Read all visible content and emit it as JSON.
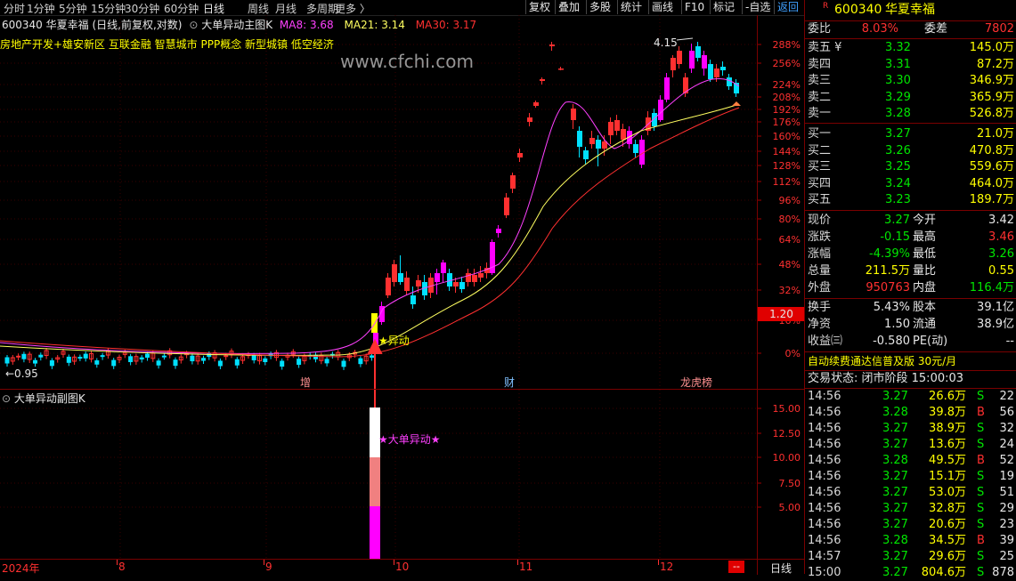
{
  "toolbar": {
    "periods": [
      "分时",
      "1分钟",
      "5分钟",
      "15分钟",
      "30分钟",
      "60分钟",
      "日线",
      "周线",
      "月线",
      "多周期",
      "更多 〉"
    ],
    "active": "日线",
    "right_buttons": [
      "复权",
      "叠加",
      "多股",
      "统计",
      "画线",
      "F10",
      "标记",
      "-自选",
      "返回"
    ]
  },
  "main_chart": {
    "stock_code": "600340",
    "stock_name": "华夏幸福",
    "desc": "(日线,前复权,对数)",
    "indicator": "大单异动主图K",
    "ma8_label": "MA8: 3.68",
    "ma21_label": "MA21: 3.14",
    "ma30_label": "MA30: 3.17",
    "concepts": "房地产开发+雄安新区 互联金融 智慧城市 PPP概念 新型城镇 低空经济",
    "watermark": "www.cfchi.com",
    "high_label": "4.15",
    "low_label": "←0.95",
    "signal_label": "★异动",
    "markers": {
      "zeng": "增",
      "cai": "财",
      "bang": "龙虎榜"
    },
    "current_price_tag": "1.20",
    "y_ticks": [
      "288%",
      "256%",
      "224%",
      "208%",
      "192%",
      "176%",
      "160%",
      "144%",
      "128%",
      "112%",
      "96%",
      "80%",
      "64%",
      "48%",
      "32%",
      "16%",
      "0%"
    ]
  },
  "sub_chart": {
    "title": "大单异动副图K",
    "signal_label": "★大单异动★",
    "y_ticks": [
      "15.00",
      "12.50",
      "10.00",
      "7.50",
      "5.00"
    ]
  },
  "x_axis": {
    "labels": [
      "2024年",
      "8",
      "9",
      "10",
      "11",
      "12"
    ],
    "end_tag": "--",
    "period_tag": "日线"
  },
  "colors": {
    "up": "#ff3030",
    "down": "#00e0ff",
    "limit": "#ff00ff",
    "ma8": "#ff40ff",
    "ma21": "#ffff60",
    "ma30": "#ff3030",
    "grid": "#7a0000"
  },
  "panel": {
    "code": "600340",
    "name": "华夏幸福",
    "r_badge": "R",
    "weibi_label": "委比",
    "weibi": "8.03%",
    "weicha_label": "委差",
    "weicha": "7802",
    "asks": [
      {
        "label": "卖五 ¥",
        "price": "3.32",
        "vol": "145.0万"
      },
      {
        "label": "卖四",
        "price": "3.31",
        "vol": "87.2万"
      },
      {
        "label": "卖三",
        "price": "3.30",
        "vol": "346.9万"
      },
      {
        "label": "卖二",
        "price": "3.29",
        "vol": "365.9万"
      },
      {
        "label": "卖一",
        "price": "3.28",
        "vol": "526.8万"
      }
    ],
    "bids": [
      {
        "label": "买一",
        "price": "3.27",
        "vol": "21.0万"
      },
      {
        "label": "买二",
        "price": "3.26",
        "vol": "470.8万"
      },
      {
        "label": "买三",
        "price": "3.25",
        "vol": "559.6万"
      },
      {
        "label": "买四",
        "price": "3.24",
        "vol": "464.0万"
      },
      {
        "label": "买五",
        "price": "3.23",
        "vol": "189.7万"
      }
    ],
    "quote": [
      {
        "l1": "现价",
        "v1": "3.27",
        "c1": "g",
        "l2": "今开",
        "v2": "3.42",
        "c2": "w"
      },
      {
        "l1": "涨跌",
        "v1": "-0.15",
        "c1": "g",
        "l2": "最高",
        "v2": "3.46",
        "c2": "r"
      },
      {
        "l1": "涨幅",
        "v1": "-4.39%",
        "c1": "g",
        "l2": "最低",
        "v2": "3.26",
        "c2": "g"
      },
      {
        "l1": "总量",
        "v1": "211.5万",
        "c1": "y",
        "l2": "量比",
        "v2": "0.55",
        "c2": "y"
      },
      {
        "l1": "外盘",
        "v1": "950763",
        "c1": "r",
        "l2": "内盘",
        "v2": "116.4万",
        "c2": "g"
      }
    ],
    "fin": [
      {
        "l1": "换手",
        "v1": "5.43%",
        "l2": "股本",
        "v2": "39.1亿"
      },
      {
        "l1": "净资",
        "v1": "1.50",
        "l2": "流通",
        "v2": "38.9亿"
      },
      {
        "l1": "收益㈢",
        "v1": "-0.580",
        "l2": "PE(动)",
        "v2": "--"
      }
    ],
    "ad": "自动续费通达信普及版  30元/月",
    "status": "交易状态: 闭市阶段 15:00:03",
    "ticks": [
      {
        "t": "14:56",
        "p": "3.27",
        "v": "26.6万",
        "s": "S",
        "n": "22"
      },
      {
        "t": "14:56",
        "p": "3.28",
        "v": "39.8万",
        "s": "B",
        "n": "56"
      },
      {
        "t": "14:56",
        "p": "3.27",
        "v": "38.9万",
        "s": "S",
        "n": "32"
      },
      {
        "t": "14:56",
        "p": "3.27",
        "v": "13.6万",
        "s": "S",
        "n": "24"
      },
      {
        "t": "14:56",
        "p": "3.28",
        "v": "49.5万",
        "s": "B",
        "n": "52"
      },
      {
        "t": "14:56",
        "p": "3.27",
        "v": "15.1万",
        "s": "S",
        "n": "19"
      },
      {
        "t": "14:56",
        "p": "3.27",
        "v": "53.0万",
        "s": "S",
        "n": "51"
      },
      {
        "t": "14:56",
        "p": "3.27",
        "v": "32.8万",
        "s": "S",
        "n": "29"
      },
      {
        "t": "14:56",
        "p": "3.27",
        "v": "20.6万",
        "s": "S",
        "n": "23"
      },
      {
        "t": "14:56",
        "p": "3.28",
        "v": "34.5万",
        "s": "B",
        "n": "39"
      },
      {
        "t": "14:57",
        "p": "3.27",
        "v": "29.6万",
        "s": "S",
        "n": "25"
      },
      {
        "t": "15:00",
        "p": "3.27",
        "v": "804.6万",
        "s": "S",
        "n": "878"
      }
    ]
  }
}
